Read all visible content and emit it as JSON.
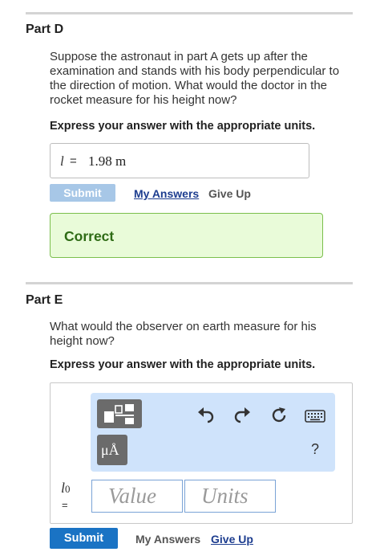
{
  "part_d": {
    "title": "Part D",
    "prompt": "Suppose the astronaut in part A gets up after the examination and stands with his body perpendicular to the direction of motion. What would the doctor in the rocket measure for his height now?",
    "express": "Express your answer with the appropriate units.",
    "answer_variable": "l",
    "answer_equals": "=",
    "answer_value": "1.98 m",
    "submit_label": "Submit",
    "my_answers_label": "My Answers",
    "give_up_label": "Give Up",
    "feedback": "Correct"
  },
  "part_e": {
    "title": "Part E",
    "prompt": "What would the observer on earth measure for his height now?",
    "express": "Express your answer with the appropriate units.",
    "variable": "l",
    "variable_sub": "0",
    "equals": "=",
    "value_placeholder": "Value",
    "units_placeholder": "Units",
    "units_button_label": "μÅ",
    "help_label": "?",
    "submit_label": "Submit",
    "my_answers_label": "My Answers",
    "give_up_label": "Give Up"
  },
  "icons": {
    "templates": "templates-icon",
    "undo": "undo-icon",
    "redo": "redo-icon",
    "reset": "reset-icon",
    "keyboard": "keyboard-icon"
  },
  "colors": {
    "link": "#1d3d8f",
    "submit_enabled": "#1a73c4",
    "submit_disabled": "#a7c7e7",
    "correct_bg": "#e9fbd9",
    "correct_border": "#7bbf4d",
    "toolbar_bg": "#cfe3fb"
  }
}
